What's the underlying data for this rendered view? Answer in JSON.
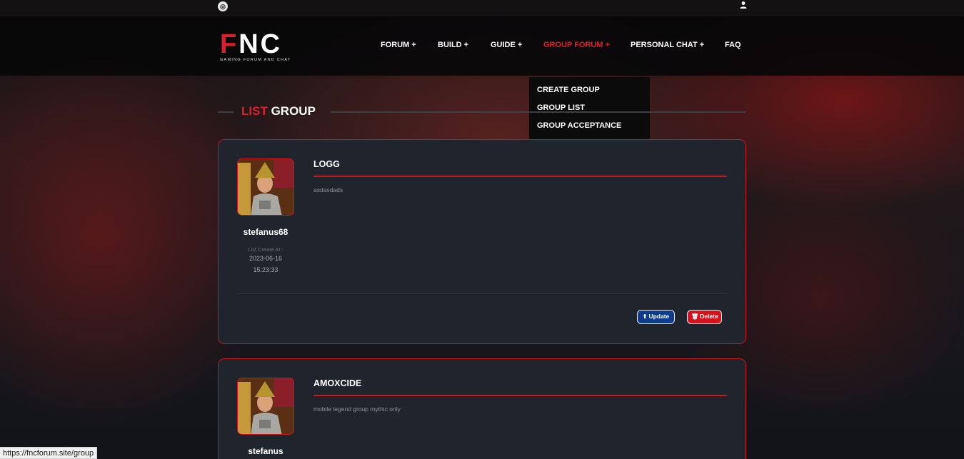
{
  "topbar": {
    "instagram_icon": "instagram-icon",
    "user_icon": "user-icon"
  },
  "brand": {
    "name_f": "F",
    "name_rest": "NC",
    "tagline": "GAMING FORUM AND CHAT"
  },
  "nav": {
    "items": [
      {
        "label": "FORUM +"
      },
      {
        "label": "BUILD +"
      },
      {
        "label": "GUIDE +"
      },
      {
        "label": "GROUP FORUM +",
        "active": true
      },
      {
        "label": "PERSONAL CHAT +"
      },
      {
        "label": "FAQ"
      }
    ]
  },
  "dropdown": {
    "items": [
      {
        "label": "CREATE GROUP"
      },
      {
        "label": "GROUP LIST"
      },
      {
        "label": "GROUP ACCEPTANCE"
      }
    ]
  },
  "section": {
    "title_highlight": "LIST",
    "title_rest": "GROUP"
  },
  "groups": [
    {
      "title": "LOGG",
      "description": "asdasdads",
      "username": "stefanus68",
      "created_label": "List Create At :",
      "created_date": "2023-06-16",
      "created_time": "15:23:33",
      "update_label": "Update",
      "delete_label": "Delete"
    },
    {
      "title": "AMOXCIDE",
      "description": "mobile legend group mythic only",
      "username": "stefanus"
    }
  ],
  "status_url": "https://fncforum.site/group",
  "colors": {
    "accent": "#e01e2b",
    "card_bg": "#20242c",
    "update_btn": "#0d3d8a",
    "delete_btn": "#d4141d"
  }
}
